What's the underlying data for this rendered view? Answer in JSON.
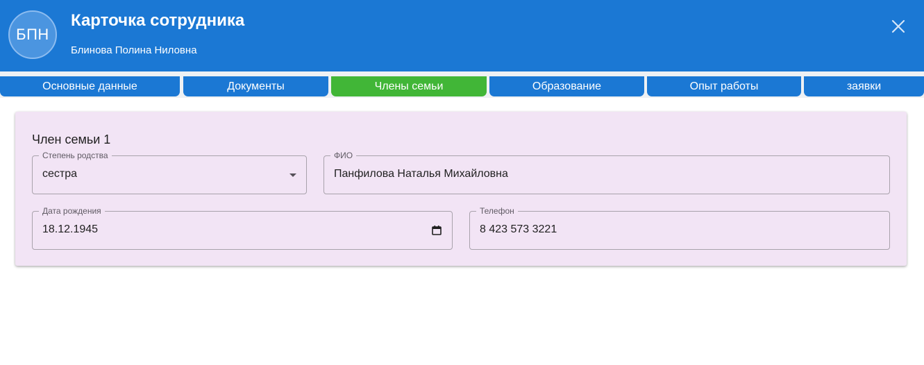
{
  "header": {
    "avatar_initials": "БПН",
    "title": "Карточка сотрудника",
    "subtitle": "Блинова Полина Ниловна",
    "background_color": "#1b78d4"
  },
  "tabs": [
    {
      "label": "Основные данные",
      "active": false
    },
    {
      "label": "Документы",
      "active": false
    },
    {
      "label": "Члены семьи",
      "active": true
    },
    {
      "label": "Образование",
      "active": false
    },
    {
      "label": "Опыт работы",
      "active": false
    },
    {
      "label": "заявки",
      "active": false
    }
  ],
  "colors": {
    "tab": "#1b78d4",
    "tab_active": "#41b637",
    "card_background": "#f2e4f5"
  },
  "family_member": {
    "title": "Член семьи 1",
    "relation": {
      "label": "Степень родства",
      "value": "сестра",
      "icon": "dropdown-arrow-icon"
    },
    "full_name": {
      "label": "ФИО",
      "value": "Панфилова Наталья Михайловна"
    },
    "birth_date": {
      "label": "Дата рождения",
      "value": "18.12.1945",
      "icon": "calendar-icon"
    },
    "phone": {
      "label": "Телефон",
      "value": "8 423 573 3221"
    }
  }
}
